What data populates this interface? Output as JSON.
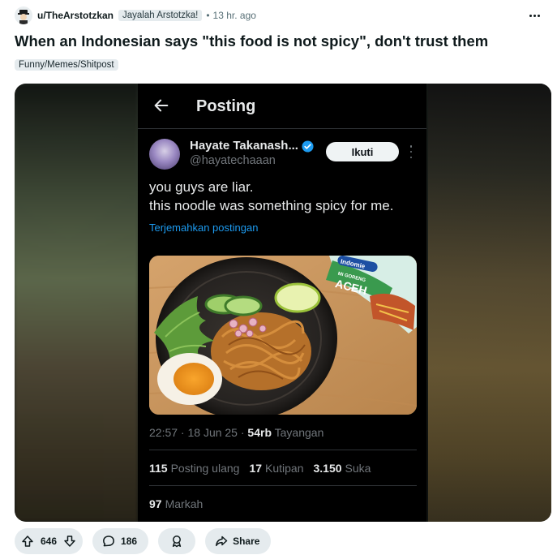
{
  "post": {
    "username": "u/TheArstotzkan",
    "user_flair": "Jayalah Arstotzka!",
    "separator": "•",
    "time": "13 hr. ago",
    "title": "When an Indonesian says \"this food is not spicy\", don't trust them",
    "flair": "Funny/Memes/Shitpost"
  },
  "tweet": {
    "header_title": "Posting",
    "name": "Hayate Takanash...",
    "handle": "@hayatechaaan",
    "follow_label": "Ikuti",
    "text_line1": "you guys are liar.",
    "text_line2": "this noodle was something spicy for me.",
    "translate": "Terjemahkan postingan",
    "package_brand": "Indomie",
    "package_variant": "MI GORENG",
    "package_flavor": "ACEH",
    "time": "22:57 · 18 Jun 25 · ",
    "views_count": "54rb",
    "views_label": "Tayangan",
    "reposts_count": "115",
    "reposts_label": "Posting ulang",
    "quotes_count": "17",
    "quotes_label": "Kutipan",
    "likes_count": "3.150",
    "likes_label": "Suka",
    "bookmarks_count": "97",
    "bookmarks_label": "Markah"
  },
  "actions": {
    "votes": "646",
    "comments": "186",
    "share_label": "Share"
  },
  "icons": [
    "avatar-icon",
    "more-icon",
    "back-arrow-icon",
    "verified-icon",
    "upvote-icon",
    "downvote-icon",
    "comment-icon",
    "award-icon",
    "share-icon"
  ],
  "colors": {
    "accent_link": "#1d9bf0",
    "verified": "#1d9bf0",
    "pill_bg": "#e5ebee"
  }
}
